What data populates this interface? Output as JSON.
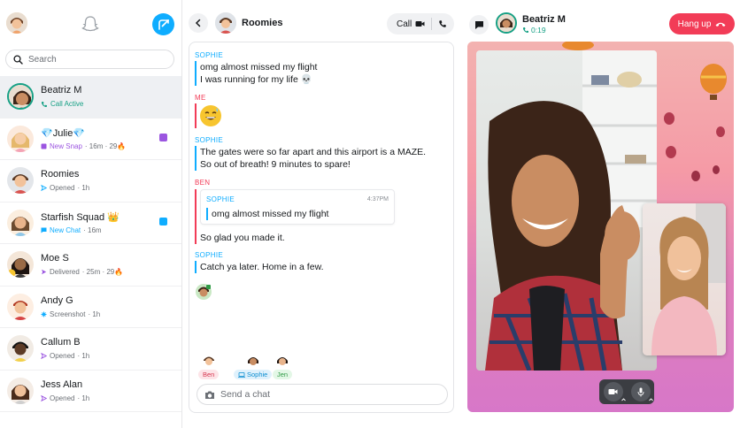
{
  "sidebar": {
    "search_placeholder": "Search",
    "chats": [
      {
        "name": "Beatriz M",
        "status": "Call Active",
        "status_color": "green",
        "meta": "",
        "active": true,
        "indicator": ""
      },
      {
        "name": "💎Julie💎",
        "status": "New Snap",
        "status_color": "purple",
        "meta": "· 16m · 29🔥",
        "active": false,
        "indicator": "#9b55e0"
      },
      {
        "name": "Roomies",
        "status": "Opened",
        "status_color": "gray",
        "meta": "· 1h",
        "active": false,
        "indicator": ""
      },
      {
        "name": "Starfish Squad 👑",
        "status": "New Chat",
        "status_color": "blue",
        "meta": "· 16m",
        "active": false,
        "indicator": "#0fadff"
      },
      {
        "name": "Moe S",
        "status": "Delivered",
        "status_color": "gray",
        "meta": "· 25m · 29🔥",
        "active": false,
        "indicator": ""
      },
      {
        "name": "Andy G",
        "status": "Screenshot",
        "status_color": "gray",
        "meta": "· 1h",
        "active": false,
        "indicator": ""
      },
      {
        "name": "Callum B",
        "status": "Opened",
        "status_color": "gray",
        "meta": "· 1h",
        "active": false,
        "indicator": ""
      },
      {
        "name": "Jess Alan",
        "status": "Opened",
        "status_color": "gray",
        "meta": "· 1h",
        "active": false,
        "indicator": ""
      }
    ]
  },
  "conversation": {
    "title": "Roomies",
    "call_label": "Call",
    "messages": [
      {
        "sender": "SOPHIE",
        "lines": [
          "omg almost missed my flight",
          "I was running for my life 💀"
        ]
      },
      {
        "sender": "ME",
        "emoji": "grinning-sweat-face"
      },
      {
        "sender": "SOPHIE",
        "lines": [
          "The gates were so far apart and this airport is a MAZE.",
          "So out of breath! 9 minutes to spare!"
        ]
      },
      {
        "sender": "BEN",
        "quote": {
          "sender": "SOPHIE",
          "time": "4:37PM",
          "text": "omg almost missed my flight"
        },
        "lines": [
          "So glad you made it."
        ]
      },
      {
        "sender": "SOPHIE",
        "lines": [
          "Catch ya later. Home in a few."
        ]
      }
    ],
    "typing": [
      "Ben",
      "Sophie",
      "Jen"
    ],
    "composer_placeholder": "Send a chat"
  },
  "call": {
    "caller_name": "Beatriz M",
    "duration": "0:19",
    "hangup_label": "Hang up"
  },
  "colors": {
    "accent_blue": "#0fadff",
    "hangup_red": "#f23c57",
    "active_green": "#16a085"
  }
}
